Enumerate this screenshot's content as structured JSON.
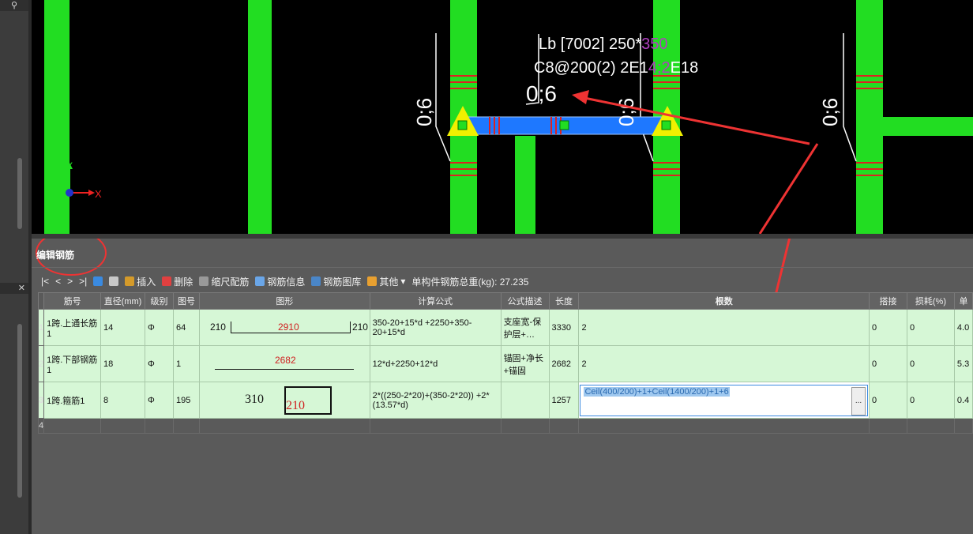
{
  "canvas": {
    "beam_label": "Lb [7002] 250*",
    "beam_label_accent": "350",
    "stirrup_text": "C8@200(2) 2E1",
    "stirrup_accent": "4;2",
    "stirrup_tail": "E18",
    "mark_large": "0;6",
    "mark_vertical": "0;6",
    "axis_y": "Y",
    "axis_x": "X"
  },
  "panel": {
    "title": "编辑钢筋",
    "nav_first": "|<",
    "nav_prev": "<",
    "nav_next": ">",
    "nav_last": ">|",
    "toolbar": {
      "insert": "插入",
      "delete": "删除",
      "scale": "缩尺配筋",
      "info": "钢筋信息",
      "library": "钢筋图库",
      "other": "其他",
      "total_label": "单构件钢筋总重(kg): 27.235"
    }
  },
  "grid": {
    "headers": [
      "筋号",
      "直径(mm)",
      "级别",
      "图号",
      "图形",
      "计算公式",
      "公式描述",
      "长度",
      "根数",
      "搭接",
      "损耗(%)",
      "单"
    ],
    "rows": [
      {
        "num": "1",
        "name": "1跨.上通长筋1",
        "dia": "14",
        "grade": "Φ",
        "fig": "64",
        "shape_left": "210",
        "shape_mid": "2910",
        "shape_right": "210",
        "formula": "350-20+15*d +2250+350-20+15*d",
        "desc": "支座宽-保护层+…",
        "len": "3330",
        "count": "2",
        "lap": "0",
        "loss": "0",
        "unit": "4.0"
      },
      {
        "num": "2",
        "name": "1跨.下部钢筋1",
        "dia": "18",
        "grade": "Φ",
        "fig": "1",
        "shape_mid": "2682",
        "formula": "12*d+2250+12*d",
        "desc": "锚固+净长+锚固",
        "len": "2682",
        "count": "2",
        "lap": "0",
        "loss": "0",
        "unit": "5.3"
      },
      {
        "num": "3",
        "name": "1跨.箍筋1",
        "dia": "8",
        "grade": "Φ",
        "fig": "195",
        "shape_left": "310",
        "shape_mid": "210",
        "formula": "2*((250-2*20)+(350-2*20)) +2*(13.57*d)",
        "desc": "",
        "len": "1257",
        "count": "Ceil(400/200)+1+Ceil(1400/200)+1+6",
        "lap": "0",
        "loss": "0",
        "unit": "0.4"
      },
      {
        "num": "4"
      }
    ],
    "editor_button": "..."
  },
  "colors": {
    "column": "#22dd22",
    "beam": "#1e78ff",
    "support": "#f0f000",
    "arrow": "#ee3333",
    "row_bg": "#d6f7d6"
  }
}
